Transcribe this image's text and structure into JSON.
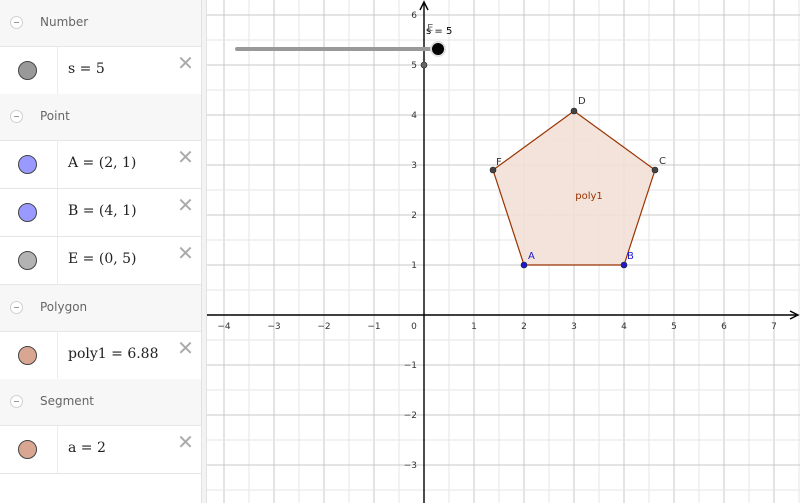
{
  "algebra": {
    "groups": [
      {
        "label": "Number",
        "items": [
          {
            "expr": "s = 5",
            "color": "#999999"
          }
        ]
      },
      {
        "label": "Point",
        "items": [
          {
            "expr": "A = (2, 1)",
            "color": "#9999ff"
          },
          {
            "expr": "B = (4, 1)",
            "color": "#9999ff"
          },
          {
            "expr": "E = (0, 5)",
            "color": "#b3b3b3"
          }
        ]
      },
      {
        "label": "Polygon",
        "items": [
          {
            "expr": "poly1 = 6.88",
            "color": "#d9a791"
          }
        ]
      },
      {
        "label": "Segment",
        "items": [
          {
            "expr": "a = 2",
            "color": "#d9a791"
          }
        ]
      }
    ]
  },
  "graph": {
    "x_range": [
      -4,
      7
    ],
    "y_range": [
      -3,
      6
    ],
    "x_ticks": [
      "−4",
      "−3",
      "−2",
      "−1",
      "0",
      "1",
      "2",
      "3",
      "4",
      "5",
      "6",
      "7"
    ],
    "y_ticks": [
      "6",
      "5",
      "4",
      "3",
      "2",
      "1",
      "−1",
      "−2",
      "−3"
    ],
    "slider": {
      "label": "s = 5",
      "value": 5
    },
    "polygon": {
      "label": "poly1",
      "color": "#993300",
      "fill": "#f2e0d6",
      "vertices": [
        {
          "name": "A",
          "x": 2,
          "y": 1
        },
        {
          "name": "B",
          "x": 4,
          "y": 1
        },
        {
          "name": "C",
          "x": 4.62,
          "y": 2.9
        },
        {
          "name": "D",
          "x": 3,
          "y": 4.08
        },
        {
          "name": "F",
          "x": 1.38,
          "y": 2.9
        }
      ]
    },
    "point_E": {
      "name": "E",
      "x": 0,
      "y": 5
    },
    "blue_point_color": "#1a1acc",
    "gray_point_color": "#444444"
  }
}
